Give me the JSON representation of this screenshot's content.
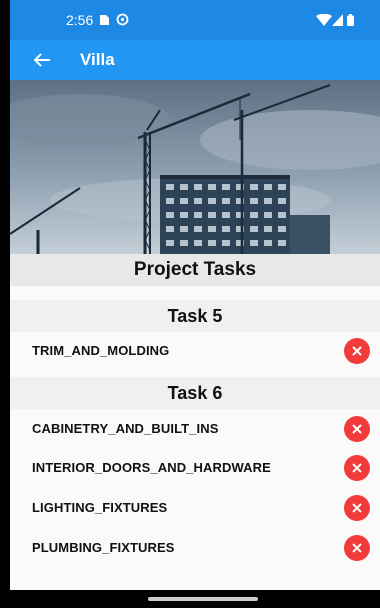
{
  "status_bar": {
    "time": "2:56"
  },
  "app_bar": {
    "title": "Villa"
  },
  "section_title": "Project Tasks",
  "groups": [
    {
      "title": "Task 5",
      "tasks": [
        "TRIM_AND_MOLDING"
      ]
    },
    {
      "title": "Task 6",
      "tasks": [
        "CABINETRY_AND_BUILT_INS",
        "INTERIOR_DOORS_AND_HARDWARE",
        "LIGHTING_FIXTURES",
        "PLUMBING_FIXTURES"
      ]
    }
  ],
  "colors": {
    "app_bar": "#2196f3",
    "status_bar": "#1e88e5",
    "delete_button": "#f23a3a"
  }
}
